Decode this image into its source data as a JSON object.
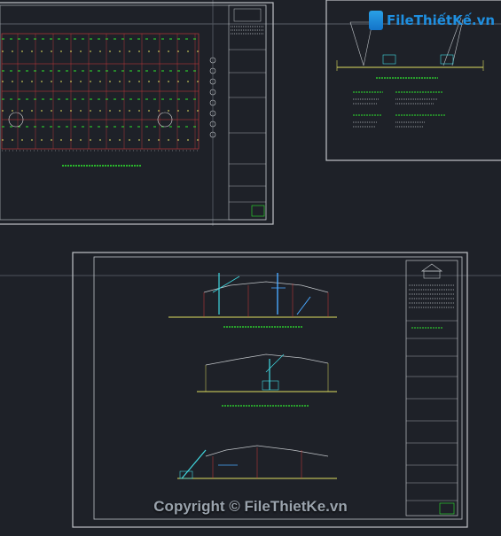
{
  "watermark": {
    "logo_text": "FileThiếtKế.vn",
    "copyright": "Copyright © FileThietKe.vn"
  },
  "colors": {
    "background": "#1e2128",
    "sheet_border": "#c0c4c8",
    "grid_red": "#d23a3a",
    "cad_green": "#2ee82e",
    "cad_yellow": "#e0e060",
    "cad_cyan": "#40d8e0",
    "cad_blue": "#4aa8ff"
  }
}
